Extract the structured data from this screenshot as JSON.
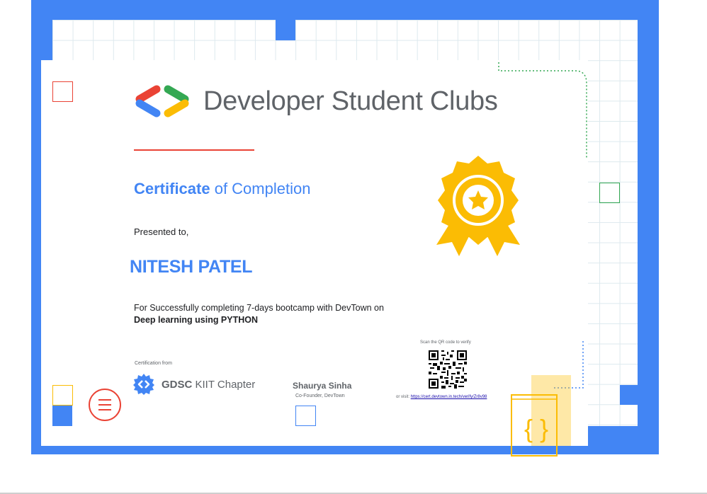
{
  "brand": {
    "name": "Developer Student Clubs"
  },
  "certificate": {
    "title_bold": "Certificate",
    "title_rest": " of Completion",
    "presented_to": "Presented to,",
    "recipient": "NITESH PATEL",
    "description": "For Successfully completing 7-days bootcamp with DevTown on",
    "course": "Deep learning using PYTHON"
  },
  "issuer": {
    "label": "Certification from",
    "chapter_bold": "GDSC",
    "chapter_rest": " KIIT Chapter"
  },
  "signatory": {
    "name": "Shaurya Sinha",
    "role": "Co-Founder, DevTown"
  },
  "verify": {
    "scan_text": "Scan the QR code to verify",
    "visit_prefix": "or visit: ",
    "url": "https://cert.devtown.in.tech/verify/Zr8v98"
  },
  "icons": {
    "logo": "dsc-chevrons-logo",
    "badge": "award-ribbon-star-icon",
    "chapter": "gdsc-gear-icon",
    "menu": "hamburger-menu-icon",
    "braces": "curly-braces-icon",
    "qr": "qr-code"
  },
  "colors": {
    "blue": "#4285f4",
    "red": "#ea4335",
    "yellow": "#fbbc04",
    "green": "#34a853",
    "grey": "#5f6368"
  }
}
